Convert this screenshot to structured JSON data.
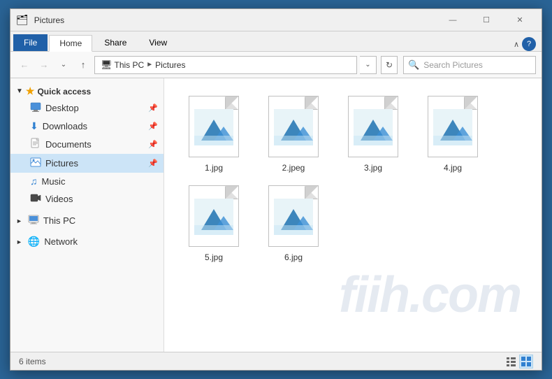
{
  "titleBar": {
    "title": "Pictures",
    "minimize": "—",
    "maximize": "☐",
    "close": "✕"
  },
  "ribbon": {
    "tabs": [
      "File",
      "Home",
      "Share",
      "View"
    ],
    "activeTab": "Home",
    "chevronLabel": "∧",
    "helpLabel": "?"
  },
  "addressBar": {
    "backLabel": "←",
    "forwardLabel": "→",
    "dropdownLabel": "⌄",
    "upLabel": "↑",
    "pathParts": [
      "This PC",
      "Pictures"
    ],
    "refreshLabel": "⟳",
    "searchPlaceholder": "Search Pictures"
  },
  "sidebar": {
    "sections": [
      {
        "name": "quick-access",
        "label": "Quick access",
        "icon": "★",
        "iconColor": "#f0a000",
        "items": [
          {
            "name": "desktop",
            "label": "Desktop",
            "icon": "🖥",
            "pinned": true
          },
          {
            "name": "downloads",
            "label": "Downloads",
            "icon": "⬇",
            "pinned": true
          },
          {
            "name": "documents",
            "label": "Documents",
            "icon": "📄",
            "pinned": true
          },
          {
            "name": "pictures",
            "label": "Pictures",
            "icon": "🖼",
            "pinned": true,
            "active": true
          }
        ]
      },
      {
        "name": "music",
        "label": "Music",
        "icon": "🎵"
      },
      {
        "name": "videos",
        "label": "Videos",
        "icon": "🎬"
      },
      {
        "name": "this-pc",
        "label": "This PC",
        "icon": "💻"
      },
      {
        "name": "network",
        "label": "Network",
        "icon": "🌐"
      }
    ]
  },
  "files": [
    {
      "name": "1.jpg",
      "type": "image"
    },
    {
      "name": "2.jpeg",
      "type": "image"
    },
    {
      "name": "3.jpg",
      "type": "image"
    },
    {
      "name": "4.jpg",
      "type": "image"
    },
    {
      "name": "5.jpg",
      "type": "image"
    },
    {
      "name": "6.jpg",
      "type": "image"
    }
  ],
  "statusBar": {
    "itemCount": "6 items"
  }
}
